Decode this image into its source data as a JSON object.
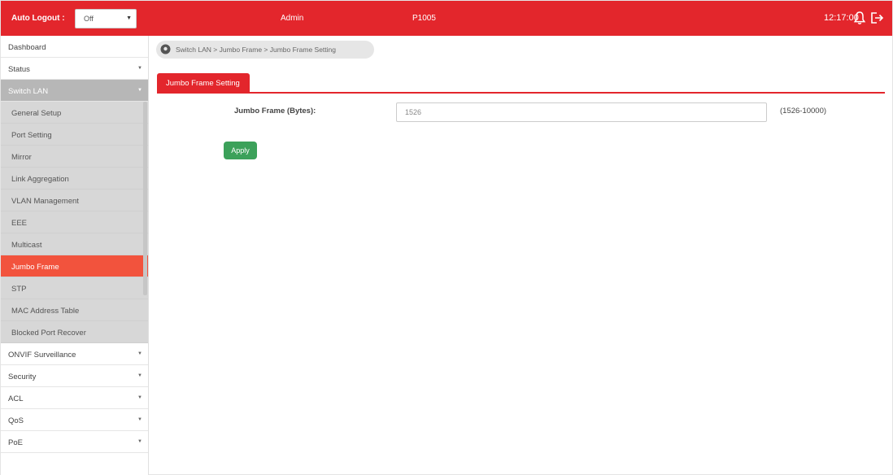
{
  "colors": {
    "brand": "#e3262c",
    "active_item": "#f2533d",
    "apply": "#3ca15a"
  },
  "topbar": {
    "auto_logout_label": "Auto Logout :",
    "auto_logout_value": "Off",
    "user": "Admin",
    "model": "P1005",
    "time": "12:17:00",
    "bell_icon": "bell-icon",
    "logout_icon": "logout-icon"
  },
  "sidebar": {
    "items_top": [
      {
        "label": "Dashboard",
        "chevron": ""
      },
      {
        "label": "Status",
        "chevron": "▼"
      }
    ],
    "open_group": {
      "label": "Switch LAN",
      "chevron": "▼"
    },
    "sub_items": [
      {
        "label": "General Setup"
      },
      {
        "label": "Port Setting"
      },
      {
        "label": "Mirror"
      },
      {
        "label": "Link Aggregation"
      },
      {
        "label": "VLAN Management"
      },
      {
        "label": "EEE"
      },
      {
        "label": "Multicast"
      },
      {
        "label": "Jumbo Frame"
      },
      {
        "label": "STP"
      },
      {
        "label": "MAC Address Table"
      },
      {
        "label": "Blocked Port Recover"
      }
    ],
    "items_bottom": [
      {
        "label": "ONVIF Surveillance",
        "chevron": "▼"
      },
      {
        "label": "Security",
        "chevron": "▼"
      },
      {
        "label": "ACL",
        "chevron": "▼"
      },
      {
        "label": "QoS",
        "chevron": "▼"
      },
      {
        "label": "PoE",
        "chevron": "▼"
      }
    ]
  },
  "breadcrumb": {
    "text": "Switch LAN > Jumbo Frame > Jumbo Frame Setting",
    "icon": "location-pin-icon"
  },
  "tab": {
    "label": "Jumbo Frame Setting"
  },
  "form": {
    "jumbo_label": "Jumbo Frame (Bytes):",
    "jumbo_value": "1526",
    "jumbo_range": "(1526-10000)",
    "apply_label": "Apply"
  }
}
